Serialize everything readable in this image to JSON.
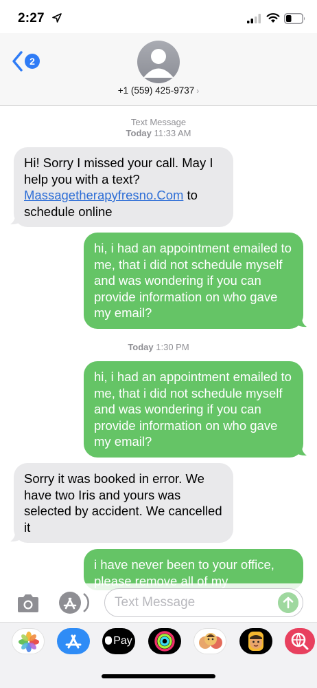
{
  "status_bar": {
    "time": "2:27"
  },
  "header": {
    "back_badge_count": "2",
    "contact_number": "+1 (559) 425-9737",
    "contact_chevron": "›"
  },
  "thread": {
    "stamp1_label": "Text Message",
    "stamp1_day": "Today",
    "stamp1_time": "11:33 AM",
    "msg1_pre": "Hi! Sorry I missed your call.  May I help you with a text? ",
    "msg1_link": "Massagetherapyfresno.Com",
    "msg1_post": " to schedule online",
    "msg2": "hi, i had an appointment emailed to me, that i did not schedule myself and was wondering if you can provide information on who gave my email?",
    "stamp2_day": "Today",
    "stamp2_time": "1:30 PM",
    "msg3": "hi, i had an appointment emailed to me, that i did not schedule myself and was wondering if you can provide information on who gave my email?",
    "msg4": "Sorry it was booked in error.  We have two Iris and yours was selected by accident. We cancelled it",
    "msg5": "i have never been to your office, please remove all of my"
  },
  "compose": {
    "placeholder": "Text Message"
  },
  "app_drawer": {
    "apps": [
      "photos-app",
      "app-store-app",
      "apple-pay-app",
      "activity-app",
      "memoji-stickers-app",
      "animoji-app",
      "search-images-app"
    ],
    "apple_pay_label": "Pay"
  },
  "colors": {
    "outgoing": "#65c466",
    "incoming": "#e9e9eb",
    "accent": "#2f7cf6"
  }
}
